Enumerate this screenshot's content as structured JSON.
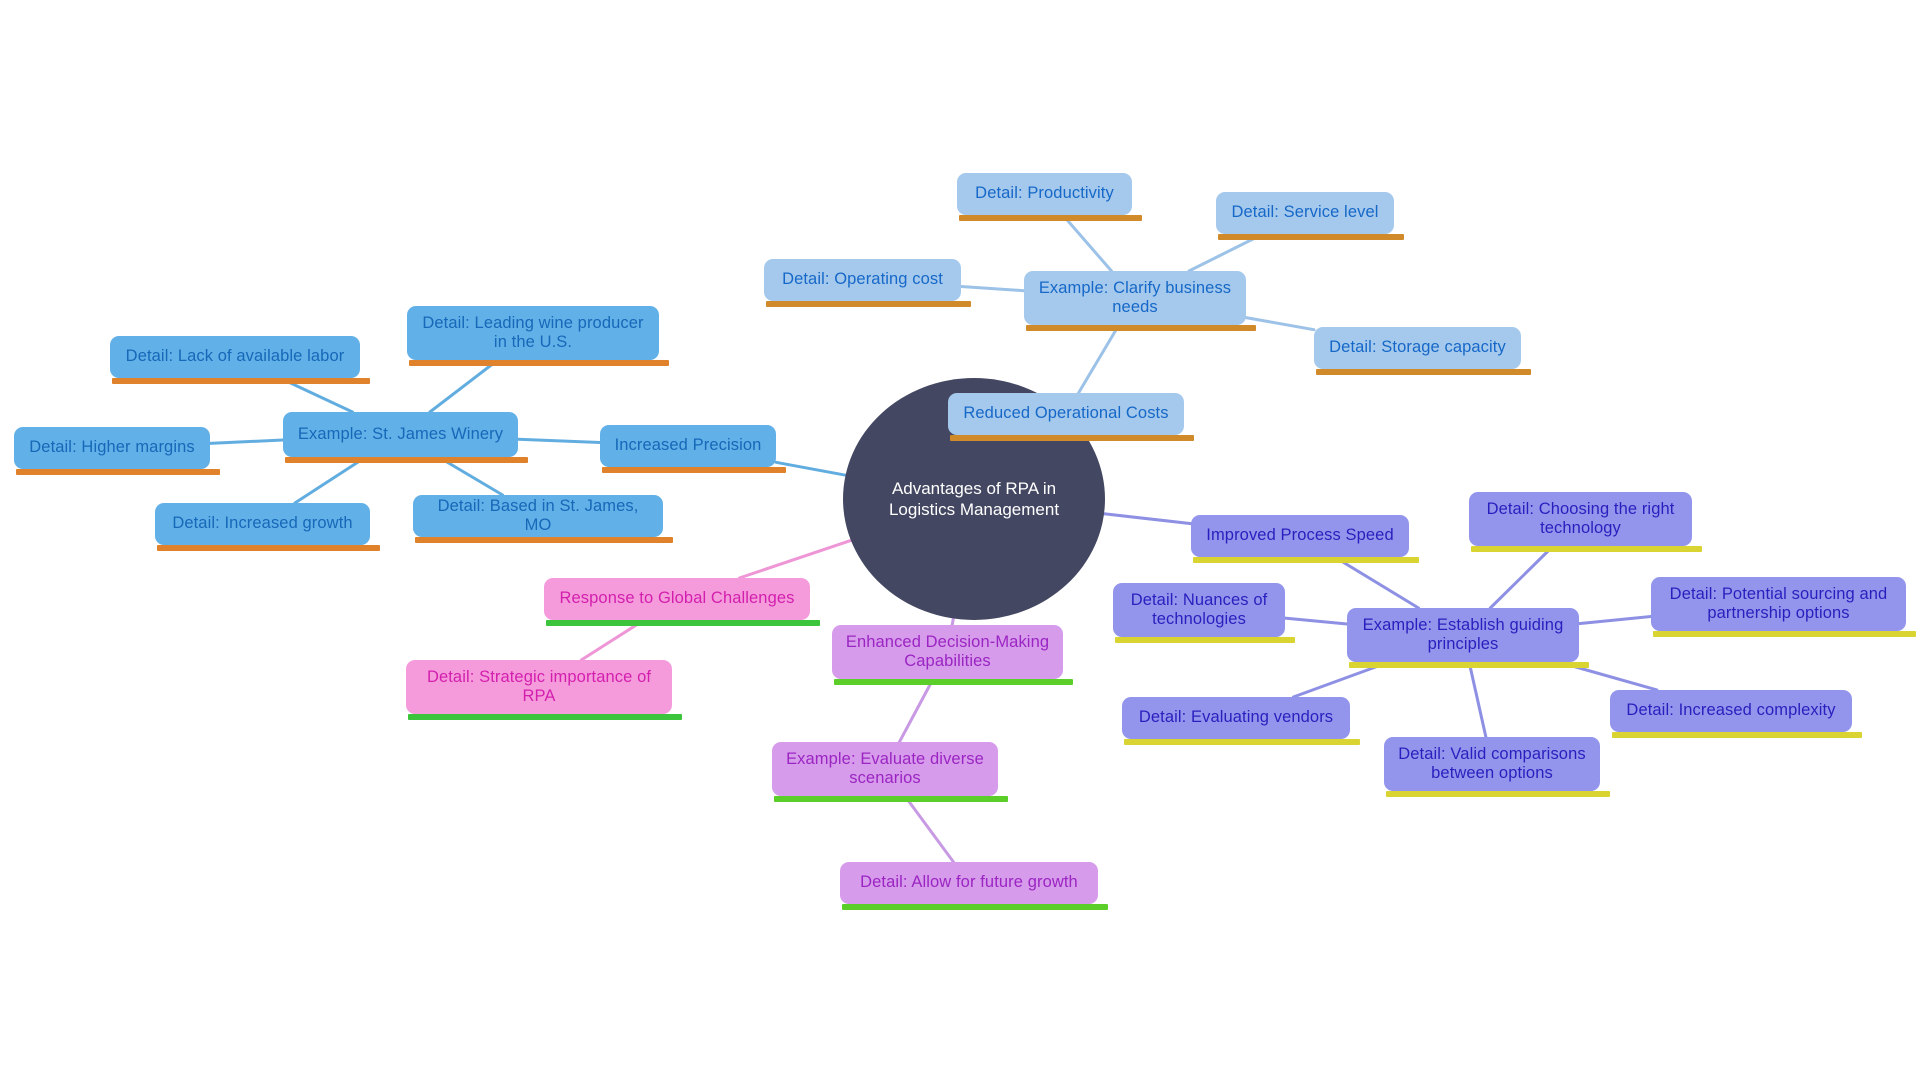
{
  "diagram": {
    "type": "mind-map",
    "title": "Advantages of RPA in Logistics Management",
    "background": "#FFFFFF",
    "center": {
      "id": "center",
      "label": "Advantages of RPA in Logistics Management",
      "fill": "#434761",
      "text_color": "#FFFFFF"
    },
    "themes": {
      "blue": {
        "fill": "#62B0E8",
        "text": "#1668B8",
        "bar": "#E0812C",
        "edge": "#62ADE0"
      },
      "lightblue": {
        "fill": "#A5C9EC",
        "text": "#1668C8",
        "bar": "#D08A2A",
        "edge": "#9CC2E8"
      },
      "periwinkle": {
        "fill": "#9395EC",
        "text": "#2A1FBE",
        "bar": "#D9D431",
        "edge": "#8E90E4"
      },
      "pink": {
        "fill": "#F59BDC",
        "text": "#D31FAE",
        "bar": "#3CC43C",
        "edge": "#EE96D6"
      },
      "orchid": {
        "fill": "#D79BEC",
        "text": "#9B25C2",
        "bar": "#5CCE2A",
        "edge": "#C99AE4"
      }
    },
    "branches": [
      {
        "id": "reduced-operational-costs",
        "label": "Reduced Operational Costs",
        "theme": "lightblue"
      },
      {
        "id": "increased-precision",
        "label": "Increased Precision",
        "theme": "blue"
      },
      {
        "id": "improved-process-speed",
        "label": "Improved Process Speed",
        "theme": "periwinkle"
      },
      {
        "id": "response-to-global-challenges",
        "label": "Response to Global Challenges",
        "theme": "pink"
      },
      {
        "id": "enhanced-decision-making",
        "label": "Enhanced Decision-Making Capabilities",
        "theme": "orchid"
      }
    ],
    "nodes": [
      {
        "id": "ex-clarify",
        "label": "Example: Clarify business needs",
        "theme": "lightblue"
      },
      {
        "id": "d-operating-cost",
        "label": "Detail: Operating cost",
        "theme": "lightblue"
      },
      {
        "id": "d-productivity",
        "label": "Detail: Productivity",
        "theme": "lightblue"
      },
      {
        "id": "d-service-level",
        "label": "Detail: Service level",
        "theme": "lightblue"
      },
      {
        "id": "d-storage",
        "label": "Detail: Storage capacity",
        "theme": "lightblue"
      },
      {
        "id": "ex-winery",
        "label": "Example: St. James Winery",
        "theme": "blue"
      },
      {
        "id": "d-lack-labor",
        "label": "Detail: Lack of available labor",
        "theme": "blue"
      },
      {
        "id": "d-leading-wine",
        "label": "Detail: Leading wine producer in the U.S.",
        "theme": "blue"
      },
      {
        "id": "d-higher-margins",
        "label": "Detail: Higher margins",
        "theme": "blue"
      },
      {
        "id": "d-increased-growth",
        "label": "Detail: Increased growth",
        "theme": "blue"
      },
      {
        "id": "d-based-stjames",
        "label": "Detail: Based in St. James, MO",
        "theme": "blue"
      },
      {
        "id": "ex-principles",
        "label": "Example: Establish guiding principles",
        "theme": "periwinkle"
      },
      {
        "id": "d-nuances",
        "label": "Detail: Nuances of technologies",
        "theme": "periwinkle"
      },
      {
        "id": "d-choosing-tech",
        "label": "Detail: Choosing the right technology",
        "theme": "periwinkle"
      },
      {
        "id": "d-sourcing",
        "label": "Detail: Potential sourcing and partnership options",
        "theme": "periwinkle"
      },
      {
        "id": "d-complexity",
        "label": "Detail: Increased complexity",
        "theme": "periwinkle"
      },
      {
        "id": "d-vendors",
        "label": "Detail: Evaluating vendors",
        "theme": "periwinkle"
      },
      {
        "id": "d-valid-comp",
        "label": "Detail: Valid comparisons between options",
        "theme": "periwinkle"
      },
      {
        "id": "d-strategic",
        "label": "Detail: Strategic importance of RPA",
        "theme": "pink"
      },
      {
        "id": "ex-scenarios",
        "label": "Example: Evaluate diverse scenarios",
        "theme": "orchid"
      },
      {
        "id": "d-future-growth",
        "label": "Detail: Allow for future growth",
        "theme": "orchid"
      }
    ],
    "edges": [
      {
        "from": "center",
        "to": "reduced-operational-costs",
        "theme": "lightblue"
      },
      {
        "from": "center",
        "to": "increased-precision",
        "theme": "blue"
      },
      {
        "from": "center",
        "to": "improved-process-speed",
        "theme": "periwinkle"
      },
      {
        "from": "center",
        "to": "response-to-global-challenges",
        "theme": "pink"
      },
      {
        "from": "center",
        "to": "enhanced-decision-making",
        "theme": "orchid"
      },
      {
        "from": "reduced-operational-costs",
        "to": "ex-clarify",
        "theme": "lightblue"
      },
      {
        "from": "ex-clarify",
        "to": "d-operating-cost",
        "theme": "lightblue"
      },
      {
        "from": "ex-clarify",
        "to": "d-productivity",
        "theme": "lightblue"
      },
      {
        "from": "ex-clarify",
        "to": "d-service-level",
        "theme": "lightblue"
      },
      {
        "from": "ex-clarify",
        "to": "d-storage",
        "theme": "lightblue"
      },
      {
        "from": "increased-precision",
        "to": "ex-winery",
        "theme": "blue"
      },
      {
        "from": "ex-winery",
        "to": "d-lack-labor",
        "theme": "blue"
      },
      {
        "from": "ex-winery",
        "to": "d-leading-wine",
        "theme": "blue"
      },
      {
        "from": "ex-winery",
        "to": "d-higher-margins",
        "theme": "blue"
      },
      {
        "from": "ex-winery",
        "to": "d-increased-growth",
        "theme": "blue"
      },
      {
        "from": "ex-winery",
        "to": "d-based-stjames",
        "theme": "blue"
      },
      {
        "from": "improved-process-speed",
        "to": "ex-principles",
        "theme": "periwinkle"
      },
      {
        "from": "ex-principles",
        "to": "d-nuances",
        "theme": "periwinkle"
      },
      {
        "from": "ex-principles",
        "to": "d-choosing-tech",
        "theme": "periwinkle"
      },
      {
        "from": "ex-principles",
        "to": "d-sourcing",
        "theme": "periwinkle"
      },
      {
        "from": "ex-principles",
        "to": "d-complexity",
        "theme": "periwinkle"
      },
      {
        "from": "ex-principles",
        "to": "d-vendors",
        "theme": "periwinkle"
      },
      {
        "from": "ex-principles",
        "to": "d-valid-comp",
        "theme": "periwinkle"
      },
      {
        "from": "response-to-global-challenges",
        "to": "d-strategic",
        "theme": "pink"
      },
      {
        "from": "enhanced-decision-making",
        "to": "ex-scenarios",
        "theme": "orchid"
      },
      {
        "from": "ex-scenarios",
        "to": "d-future-growth",
        "theme": "orchid"
      }
    ]
  }
}
